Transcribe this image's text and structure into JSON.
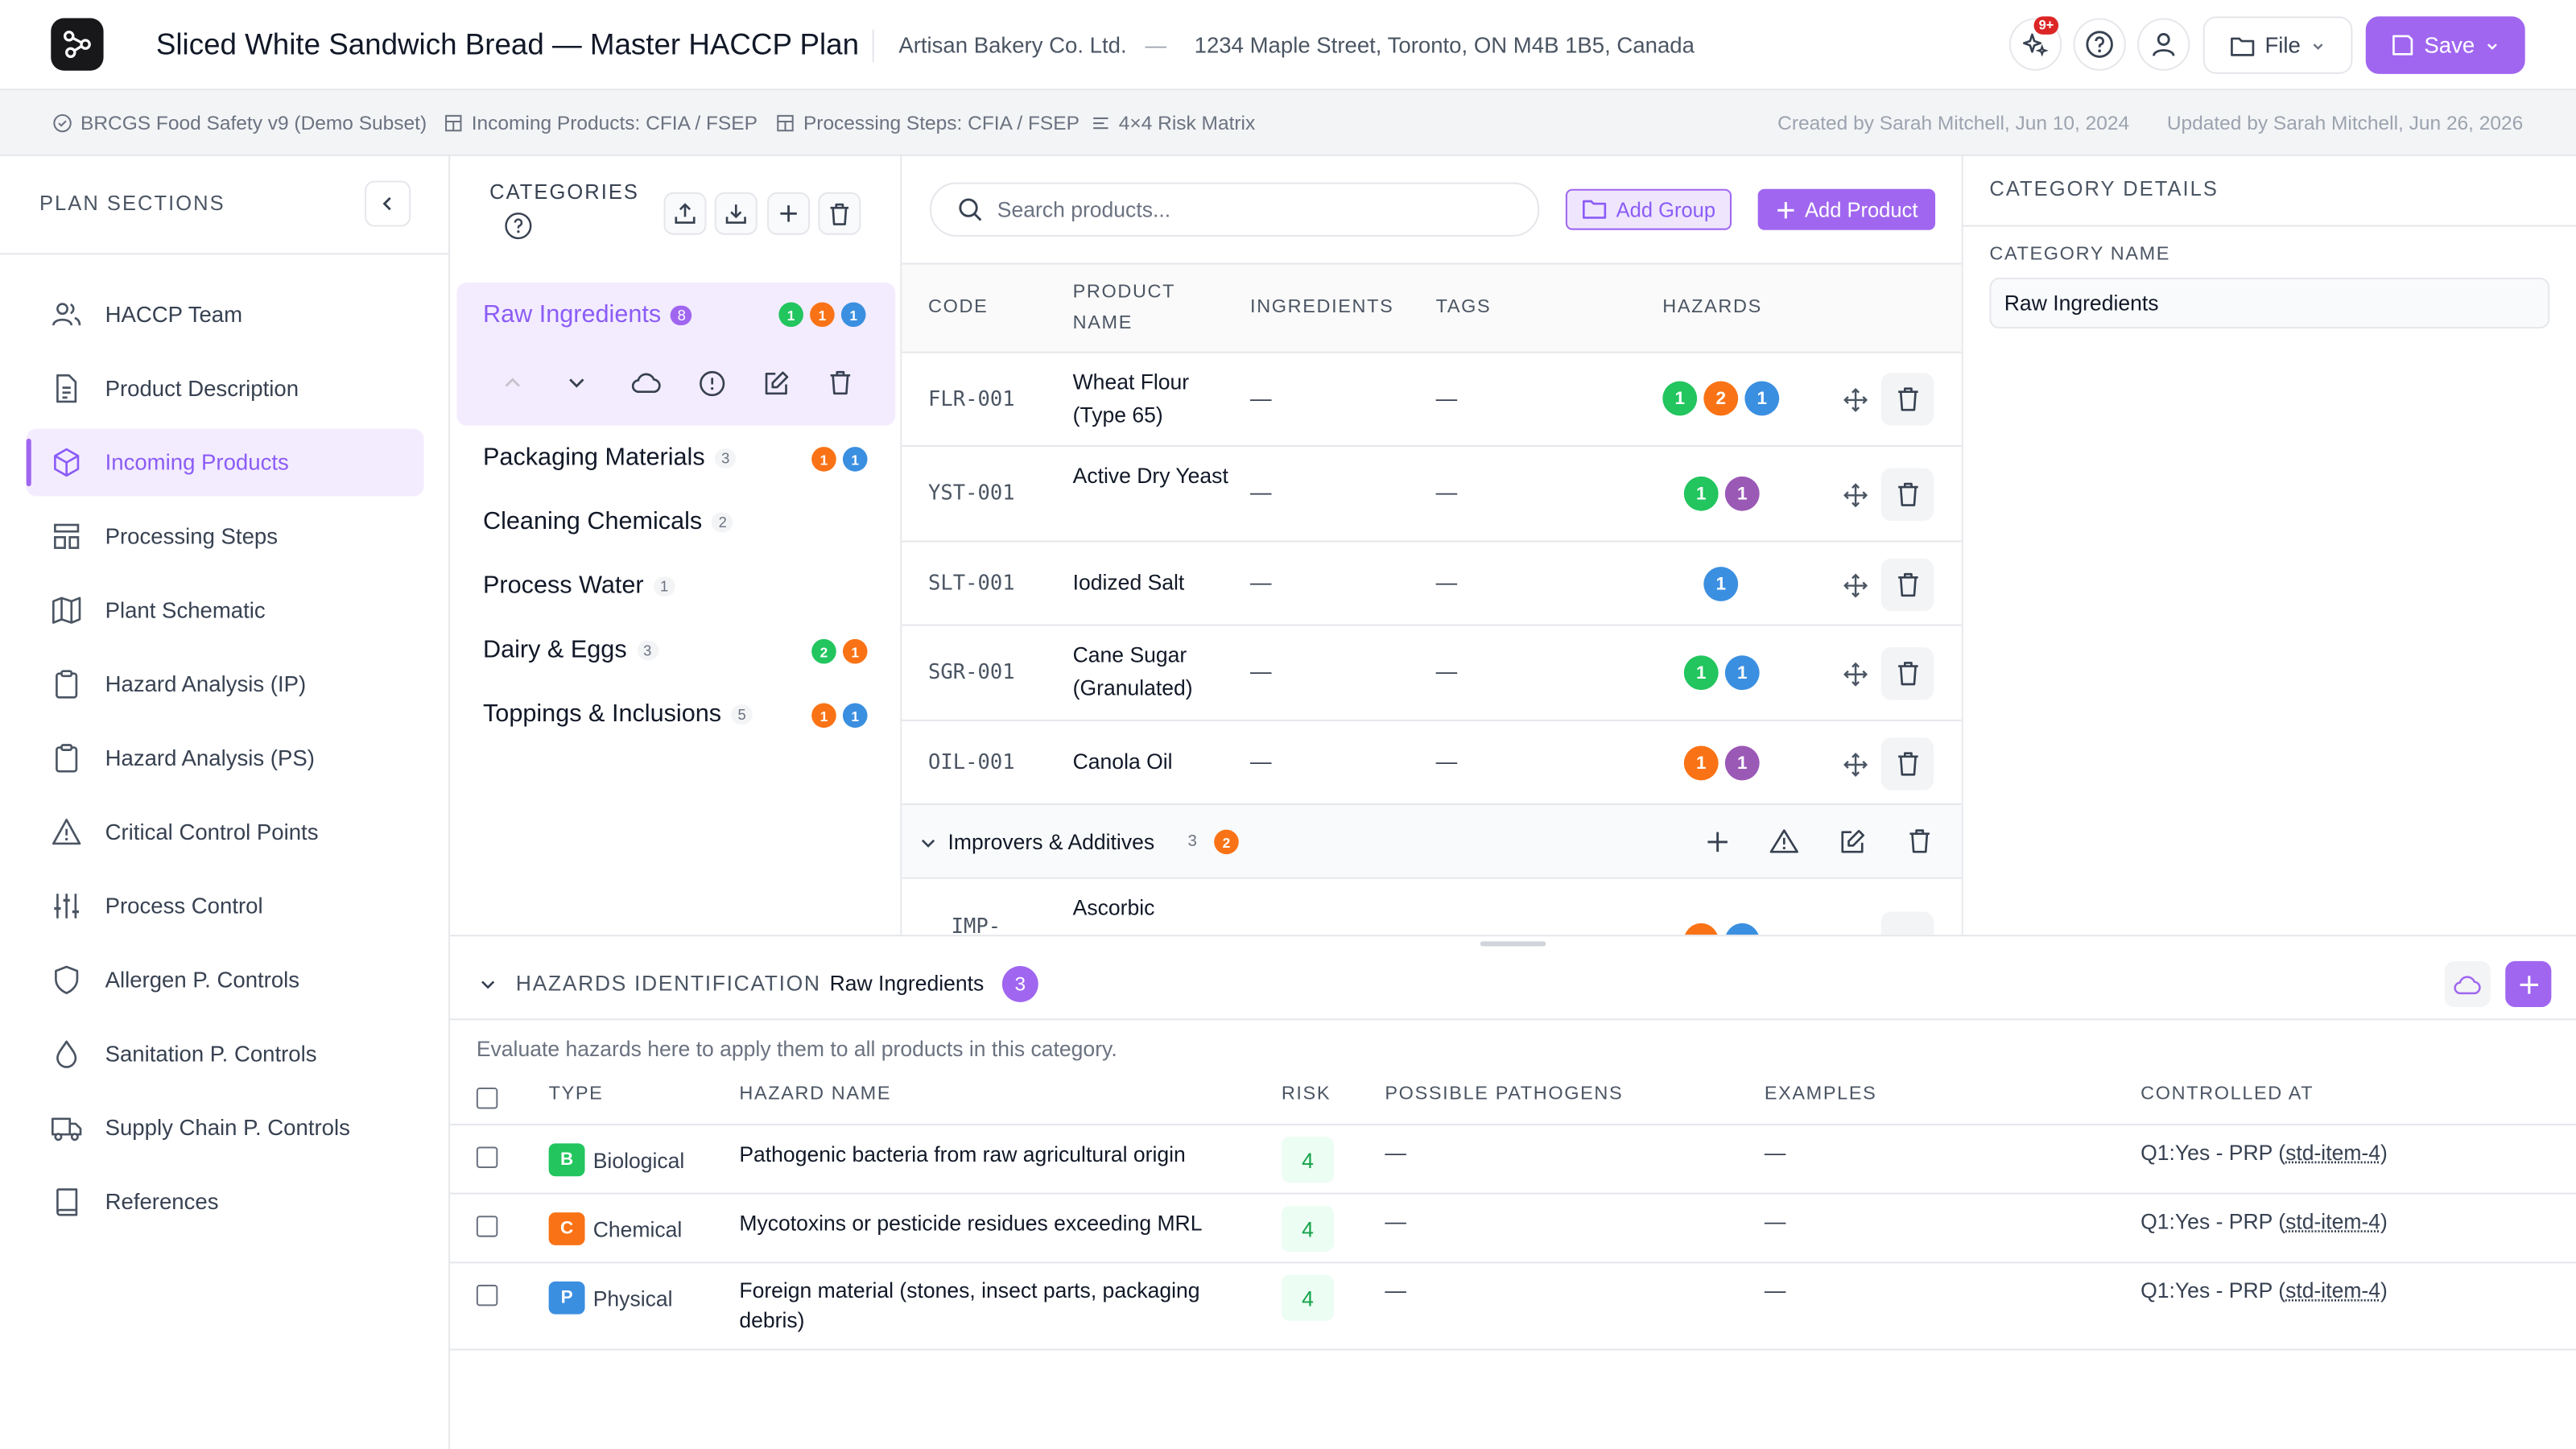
{
  "header": {
    "title": "Sliced White Sandwich Bread — Master HACCP Plan",
    "company": "Artisan Bakery Co. Ltd.",
    "separator": "—",
    "address": "1234 Maple Street, Toronto, ON M4B 1B5, Canada",
    "notifications": "9+",
    "file_label": "File",
    "save_label": "Save"
  },
  "subheader": {
    "standard": "BRCGS Food Safety v9 (Demo Subset)",
    "incoming": "Incoming Products: CFIA / FSEP",
    "processing": "Processing Steps: CFIA / FSEP",
    "matrix": "4×4 Risk Matrix",
    "created": "Created by Sarah Mitchell, Jun 10, 2024",
    "updated": "Updated by Sarah Mitchell, Jun 26, 2026"
  },
  "sidebar": {
    "heading": "PLAN SECTIONS",
    "items": [
      {
        "label": "HACCP Team",
        "icon": "users-icon"
      },
      {
        "label": "Product Description",
        "icon": "document-icon"
      },
      {
        "label": "Incoming Products",
        "icon": "box-icon",
        "active": true
      },
      {
        "label": "Processing Steps",
        "icon": "steps-icon"
      },
      {
        "label": "Plant Schematic",
        "icon": "map-icon"
      },
      {
        "label": "Hazard Analysis (IP)",
        "icon": "clipboard-icon"
      },
      {
        "label": "Hazard Analysis (PS)",
        "icon": "clipboard-icon"
      },
      {
        "label": "Critical Control Points",
        "icon": "warning-icon"
      },
      {
        "label": "Process Control",
        "icon": "sliders-icon"
      },
      {
        "label": "Allergen P. Controls",
        "icon": "shield-icon"
      },
      {
        "label": "Sanitation P. Controls",
        "icon": "droplet-icon"
      },
      {
        "label": "Supply Chain P. Controls",
        "icon": "truck-icon"
      },
      {
        "label": "References",
        "icon": "book-icon"
      }
    ]
  },
  "categories": {
    "heading": "CATEGORIES",
    "items": [
      {
        "name": "Raw Ingredients",
        "count": "8",
        "hazards": [
          [
            "g",
            "1"
          ],
          [
            "o",
            "1"
          ],
          [
            "b",
            "1"
          ]
        ],
        "selected": true
      },
      {
        "name": "Packaging Materials",
        "count": "3",
        "hazards": [
          [
            "o",
            "1"
          ],
          [
            "b",
            "1"
          ]
        ]
      },
      {
        "name": "Cleaning Chemicals",
        "count": "2",
        "hazards": []
      },
      {
        "name": "Process Water",
        "count": "1",
        "hazards": []
      },
      {
        "name": "Dairy & Eggs",
        "count": "3",
        "hazards": [
          [
            "g",
            "2"
          ],
          [
            "o",
            "1"
          ]
        ]
      },
      {
        "name": "Toppings & Inclusions",
        "count": "5",
        "hazards": [
          [
            "o",
            "1"
          ],
          [
            "b",
            "1"
          ]
        ]
      }
    ]
  },
  "products": {
    "search_placeholder": "Search products...",
    "add_group": "Add Group",
    "add_product": "Add Product",
    "columns": {
      "code": "CODE",
      "name_1": "PRODUCT",
      "name_2": "NAME",
      "ingredients": "INGREDIENTS",
      "tags": "TAGS",
      "hazards": "HAZARDS"
    },
    "rows": [
      {
        "code": "FLR-001",
        "name": "Wheat Flour (Type 65)",
        "ingredients": "—",
        "tags": "—",
        "hazards": [
          [
            "g",
            "1"
          ],
          [
            "o",
            "2"
          ],
          [
            "b",
            "1"
          ]
        ]
      },
      {
        "code": "YST-001",
        "name": "Active Dry Yeast",
        "ingredients": "—",
        "tags": "—",
        "hazards": [
          [
            "g",
            "1"
          ],
          [
            "p",
            "1"
          ]
        ]
      },
      {
        "code": "SLT-001",
        "name": "Iodized Salt",
        "ingredients": "—",
        "tags": "—",
        "hazards": [
          [
            "b",
            "1"
          ]
        ]
      },
      {
        "code": "SGR-001",
        "name": "Cane Sugar (Granulated)",
        "ingredients": "—",
        "tags": "—",
        "hazards": [
          [
            "g",
            "1"
          ],
          [
            "b",
            "1"
          ]
        ]
      },
      {
        "code": "OIL-001",
        "name": "Canola Oil",
        "ingredients": "—",
        "tags": "—",
        "hazards": [
          [
            "o",
            "1"
          ],
          [
            "p",
            "1"
          ]
        ]
      }
    ],
    "group": {
      "name": "Improvers & Additives",
      "count": "3",
      "badge": "2"
    },
    "partial_row": {
      "code": "IMP-",
      "name": "Ascorbic"
    }
  },
  "details": {
    "heading": "CATEGORY DETAILS",
    "label": "CATEGORY NAME",
    "value": "Raw Ingredients"
  },
  "hazards": {
    "heading": "HAZARDS IDENTIFICATION",
    "separator": "·",
    "category": "Raw Ingredients",
    "count": "3",
    "hint": "Evaluate hazards here to apply them to all products in this category.",
    "columns": {
      "type": "TYPE",
      "name": "HAZARD NAME",
      "risk": "RISK",
      "pathogens": "POSSIBLE PATHOGENS",
      "examples": "EXAMPLES",
      "controlled": "CONTROLLED AT"
    },
    "rows": [
      {
        "letter": "B",
        "type": "Biological",
        "color": "#22c55e",
        "name": "Pathogenic bacteria from raw agricultural origin",
        "risk": "4",
        "pathogens": "—",
        "examples": "—",
        "controlled": "Q1:Yes - PRP (",
        "ref": "std-item-4",
        "close": ")"
      },
      {
        "letter": "C",
        "type": "Chemical",
        "color": "#f97316",
        "name": "Mycotoxins or pesticide residues exceeding MRL",
        "risk": "4",
        "pathogens": "—",
        "examples": "—",
        "controlled": "Q1:Yes - PRP (",
        "ref": "std-item-4",
        "close": ")"
      },
      {
        "letter": "P",
        "type": "Physical",
        "color": "#3b8fe0",
        "name": "Foreign material (stones, insect parts, packaging debris)",
        "risk": "4",
        "pathogens": "—",
        "examples": "—",
        "controlled": "Q1:Yes - PRP (",
        "ref": "std-item-4",
        "close": ")"
      }
    ]
  },
  "colors": {
    "accent": "#a066f0",
    "green": "#22c55e",
    "orange": "#f97316",
    "blue": "#3b8fe0",
    "purple": "#9b59b6"
  }
}
